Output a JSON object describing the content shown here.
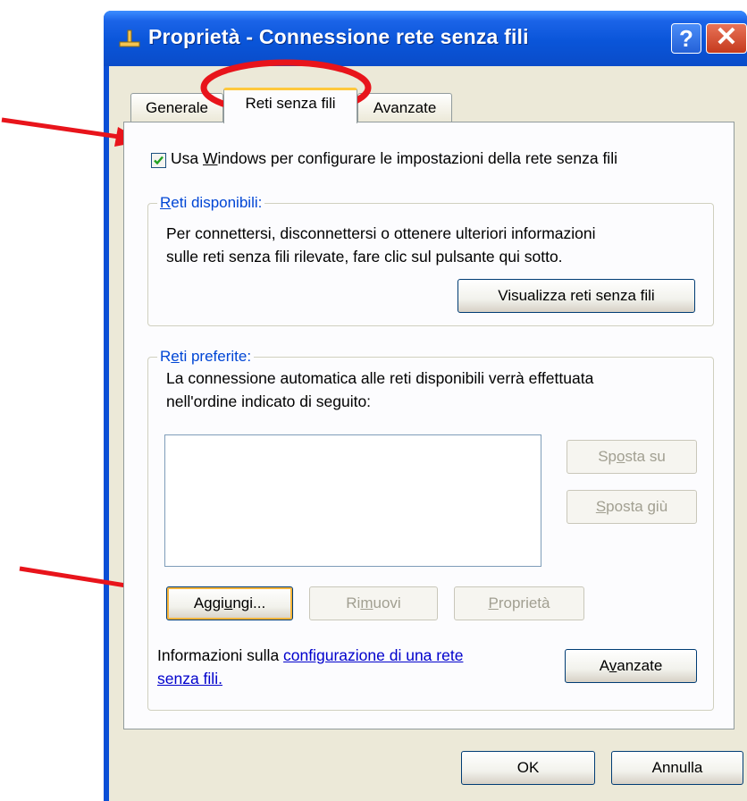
{
  "window": {
    "title": "Proprietà - Connessione rete senza fili",
    "help_label": "?",
    "close_label": "✕"
  },
  "tabs": [
    {
      "label": "Generale"
    },
    {
      "label": "Reti senza fili"
    },
    {
      "label": "Avanzate"
    }
  ],
  "wireless": {
    "checkbox": {
      "checked": true,
      "label_prefix": "Usa ",
      "label_accel": "W",
      "label_rest": "indows per configurare le impostazioni della rete senza fili"
    },
    "available": {
      "title_accel": "R",
      "title_rest": "eti disponibili:",
      "text_line1": "Per connettersi, disconnettersi o ottenere ulteriori informazioni",
      "text_line2": "sulle reti senza fili rilevate, fare clic sul pulsante qui sotto.",
      "button": "Visualizza reti senza fili"
    },
    "preferred": {
      "title_pre": "R",
      "title_accel": "e",
      "title_rest": "ti preferite:",
      "text_line1": "La connessione automatica alle reti disponibili verrà effettuata",
      "text_line2": "nell'ordine indicato di seguito:",
      "move_up": {
        "pre": "Sp",
        "accel": "o",
        "rest": "sta su"
      },
      "move_down": {
        "pre": "",
        "accel": "S",
        "rest": "posta giù"
      },
      "add": {
        "pre": "Aggi",
        "accel": "u",
        "rest": "ngi..."
      },
      "remove": {
        "pre": "Ri",
        "accel": "m",
        "rest": "uovi"
      },
      "properties": {
        "pre": "",
        "accel": "P",
        "rest": "roprietà"
      },
      "info_prefix": "Informazioni sulla ",
      "info_link_line1": "configurazione di una rete",
      "info_link_line2": "senza fili.",
      "advanced": {
        "pre": "A",
        "accel": "v",
        "rest": "anzate"
      }
    }
  },
  "footer": {
    "ok": "OK",
    "cancel": "Annulla"
  },
  "annotation_color": "#e8141b"
}
